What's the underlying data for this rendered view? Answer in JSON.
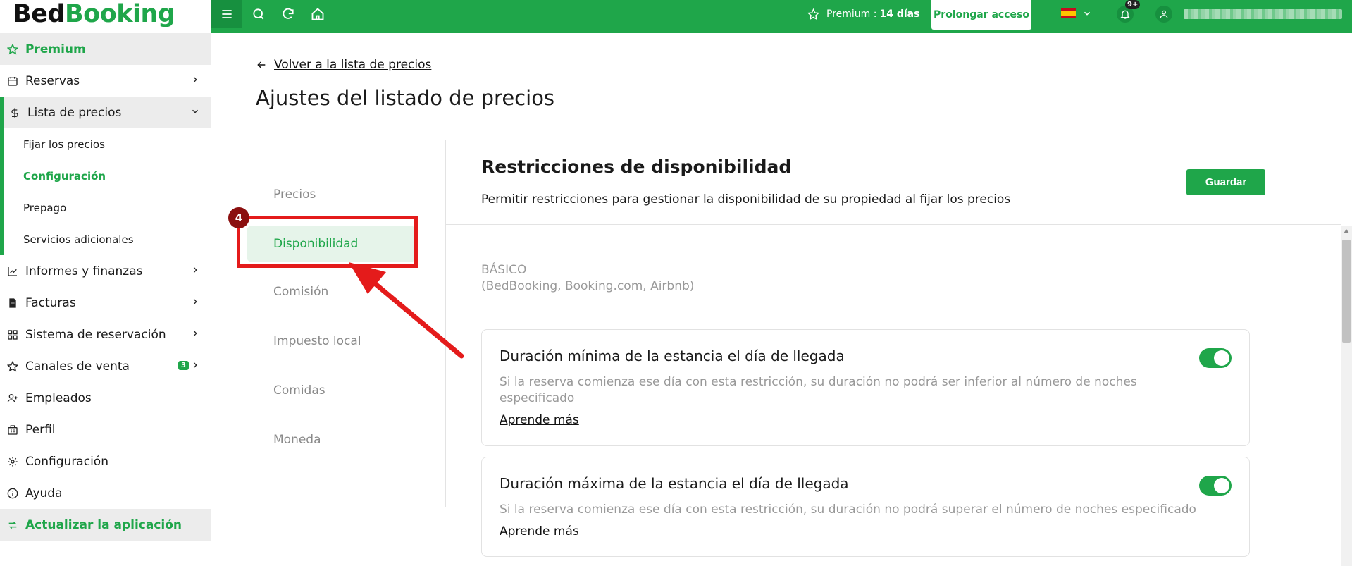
{
  "logo": {
    "part1": "Bed",
    "part2": "Booking"
  },
  "sidebar": {
    "items": [
      {
        "label": "Premium",
        "icon": "star-icon"
      },
      {
        "label": "Reservas",
        "icon": "calendar-icon"
      },
      {
        "label": "Lista de precios",
        "icon": "dollar-icon"
      },
      {
        "label": "Informes y finanzas",
        "icon": "chart-icon"
      },
      {
        "label": "Facturas",
        "icon": "invoice-icon"
      },
      {
        "label": "Sistema de reservación",
        "icon": "grid-icon"
      },
      {
        "label": "Canales de venta",
        "icon": "star-icon",
        "badge": "3"
      },
      {
        "label": "Empleados",
        "icon": "user-plus-icon"
      },
      {
        "label": "Perfil",
        "icon": "building-icon"
      },
      {
        "label": "Configuración",
        "icon": "gear-icon"
      },
      {
        "label": "Ayuda",
        "icon": "info-icon"
      },
      {
        "label": "Actualizar la aplicación",
        "icon": "refresh-icon"
      }
    ],
    "sub_items": [
      {
        "label": "Fijar los precios"
      },
      {
        "label": "Configuración"
      },
      {
        "label": "Prepago"
      },
      {
        "label": "Servicios adicionales"
      }
    ]
  },
  "topbar": {
    "premium_label": "Premium :",
    "premium_days": "14 días",
    "prolong_label": "Prolongar acceso",
    "notifications_count": "9+",
    "language": "es"
  },
  "header": {
    "back_label": "Volver a la lista de precios",
    "title": "Ajustes del listado de precios"
  },
  "tabs": [
    {
      "label": "Precios"
    },
    {
      "label": "Disponibilidad"
    },
    {
      "label": "Comisión"
    },
    {
      "label": "Impuesto local"
    },
    {
      "label": "Comidas"
    },
    {
      "label": "Moneda"
    }
  ],
  "annotation": {
    "step": "4"
  },
  "section": {
    "title": "Restricciones de disponibilidad",
    "description": "Permitir restricciones para gestionar la disponibilidad de su propiedad al fijar los precios",
    "save_label": "Guardar",
    "basic_label": "BÁSICO",
    "basic_sub": "(BedBooking, Booking.com, Airbnb)"
  },
  "cards": [
    {
      "title": "Duración mínima de la estancia el día de llegada",
      "description": "Si la reserva comienza ese día con esta restricción, su duración no podrá ser inferior al número de noches especificado",
      "link": "Aprende más",
      "enabled": true
    },
    {
      "title": "Duración máxima de la estancia el día de llegada",
      "description": "Si la reserva comienza ese día con esta restricción, su duración no podrá superar el número de noches especificado",
      "link": "Aprende más",
      "enabled": true
    }
  ],
  "colors": {
    "brand": "#1fa64a",
    "annotation": "#e41b1b"
  }
}
